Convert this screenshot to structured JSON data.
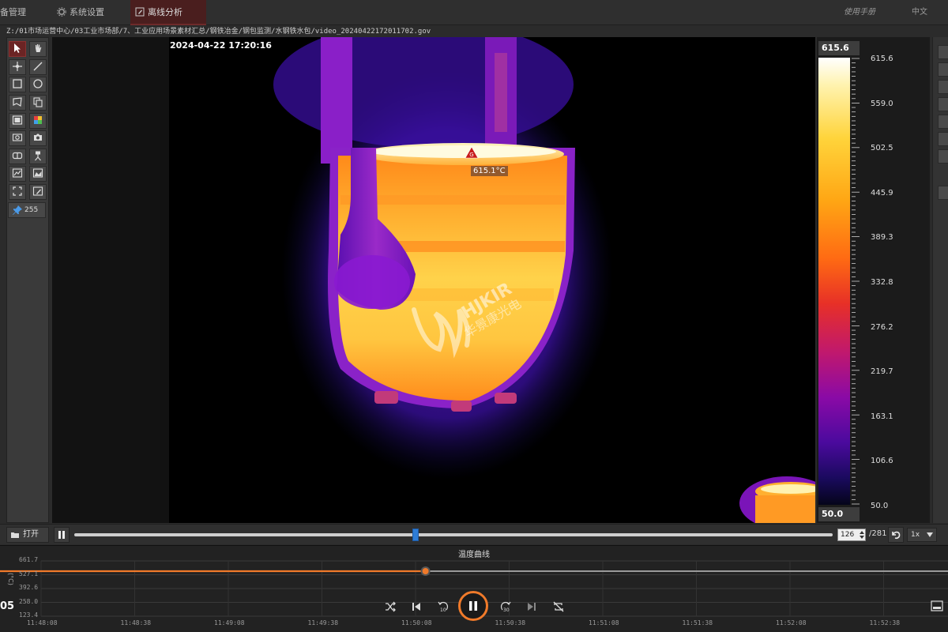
{
  "topbar": {
    "tabs": [
      {
        "label": "备管理",
        "icon": "device-icon"
      },
      {
        "label": "系统设置",
        "icon": "gear-icon"
      },
      {
        "label": "离线分析",
        "icon": "edit-icon",
        "active": true
      }
    ],
    "right_link": "使用手册",
    "language": "中文"
  },
  "file_path": "Z:/01市场运营中心/03工业市场部/7、工业应用场景素材汇总/钢铁冶金/钢包监测/水钢铁水包/video_20240422172011702.gov",
  "viewer": {
    "timestamp": "2024-04-22 17:20:16",
    "marker_letter": "G",
    "marker_temp": "615.1°C",
    "watermark_brand": "HJKIR",
    "watermark_company": "华景康光电"
  },
  "scale": {
    "max_box": "615.6",
    "min_box": "50.0",
    "labels": [
      "615.6",
      "559.0",
      "502.5",
      "445.9",
      "389.3",
      "332.8",
      "276.2",
      "219.7",
      "163.1",
      "106.6",
      "50.0"
    ]
  },
  "tools": {
    "pin_count": "255"
  },
  "playback": {
    "open_label": "打开",
    "frame_current": "126",
    "frame_total": "/281",
    "speed": "1x",
    "progress": 0.45
  },
  "curve": {
    "title": "温度曲线",
    "unit": "(°C)",
    "left_value": "05",
    "y_ticks": [
      "661.7",
      "527.1",
      "392.6",
      "258.0",
      "123.4"
    ],
    "x_ticks": [
      "11:48:08",
      "11:48:38",
      "11:49:08",
      "11:49:38",
      "11:50:08",
      "11:50:38",
      "11:51:08",
      "11:51:38",
      "11:52:08",
      "11:52:38"
    ],
    "line_color": "#f07a2a",
    "cursor_progress": 0.45
  }
}
